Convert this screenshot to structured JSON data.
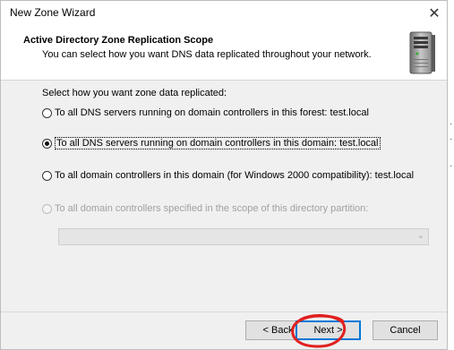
{
  "window": {
    "title": "New Zone Wizard",
    "close_label": "✕"
  },
  "header": {
    "title": "Active Directory Zone Replication Scope",
    "subtitle": "You can select how you want DNS data replicated throughout your network.",
    "icon": "server-icon"
  },
  "main": {
    "prompt": "Select how you want zone data replicated:",
    "options": [
      {
        "label": "To all DNS servers running on domain controllers in this forest: test.local",
        "selected": false,
        "enabled": true
      },
      {
        "label": "To all DNS servers running on domain controllers in this domain: test.local",
        "selected": true,
        "enabled": true
      },
      {
        "label": "To all domain controllers in this domain (for Windows 2000 compatibility): test.local",
        "selected": false,
        "enabled": true
      },
      {
        "label": "To all domain controllers specified in the scope of this directory partition:",
        "selected": false,
        "enabled": false
      }
    ],
    "partition_combo": {
      "value": "",
      "enabled": false
    }
  },
  "footer": {
    "back_label": "< Back",
    "next_label": "Next >",
    "cancel_label": "Cancel"
  },
  "annotation": {
    "color": "#e02020"
  }
}
